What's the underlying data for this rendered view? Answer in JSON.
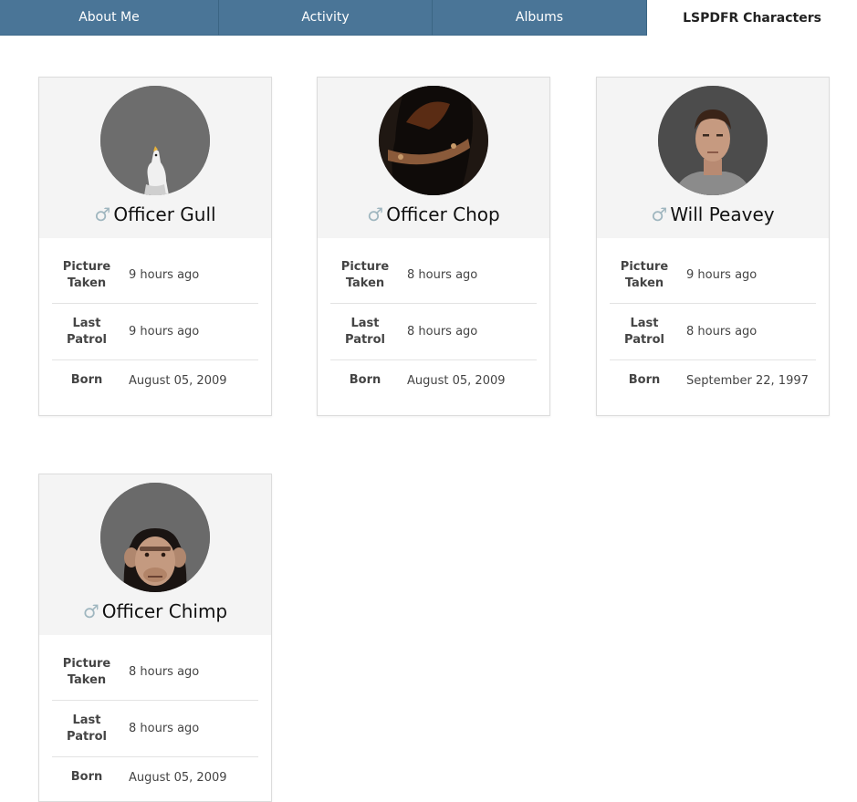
{
  "tabs": [
    {
      "label": "About Me",
      "active": false
    },
    {
      "label": "Activity",
      "active": false
    },
    {
      "label": "Albums",
      "active": false
    },
    {
      "label": "LSPDFR Characters",
      "active": true
    }
  ],
  "labels": {
    "picture_taken": "Picture Taken",
    "last_patrol": "Last Patrol",
    "born": "Born"
  },
  "gender_symbol": "♂",
  "characters": [
    {
      "name": "Officer Gull",
      "avatar_icon": "seagull",
      "picture_taken": "9 hours ago",
      "last_patrol": "9 hours ago",
      "born": "August 05, 2009"
    },
    {
      "name": "Officer Chop",
      "avatar_icon": "rottweiler-dog",
      "picture_taken": "8 hours ago",
      "last_patrol": "8 hours ago",
      "born": "August 05, 2009"
    },
    {
      "name": "Will Peavey",
      "avatar_icon": "man-portrait",
      "picture_taken": "9 hours ago",
      "last_patrol": "8 hours ago",
      "born": "September 22, 1997"
    },
    {
      "name": "Officer Chimp",
      "avatar_icon": "chimpanzee",
      "picture_taken": "8 hours ago",
      "last_patrol": "8 hours ago",
      "born": "August 05, 2009"
    }
  ],
  "colors": {
    "tab_bar": "#4a7597",
    "card_header": "#f4f4f4",
    "gender_icon": "#9fb6bf"
  }
}
